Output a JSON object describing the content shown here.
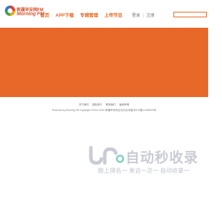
{
  "header": {
    "logo_cn": "新疆早安网FM",
    "logo_en": "Morning FM",
    "nav": [
      "首页",
      "APP下载",
      "专辑管理",
      "上传节目"
    ],
    "login": "登录",
    "separator": "|",
    "register": "注册"
  },
  "colors": {
    "accent": "#e8682a",
    "nav": "#e8641f"
  },
  "footer": {
    "links": [
      "关于我们",
      "团队简介",
      "联系我们",
      "版权声明"
    ],
    "copyright": "Powered by Morning FM   Copyright ©2011-2021 新疆早安网互动文化传播 苏ICP备12345678号"
  },
  "watermark": {
    "title": "自动秒收录",
    "subtitle": "做上排名一 来访一次一 自动收录一"
  }
}
